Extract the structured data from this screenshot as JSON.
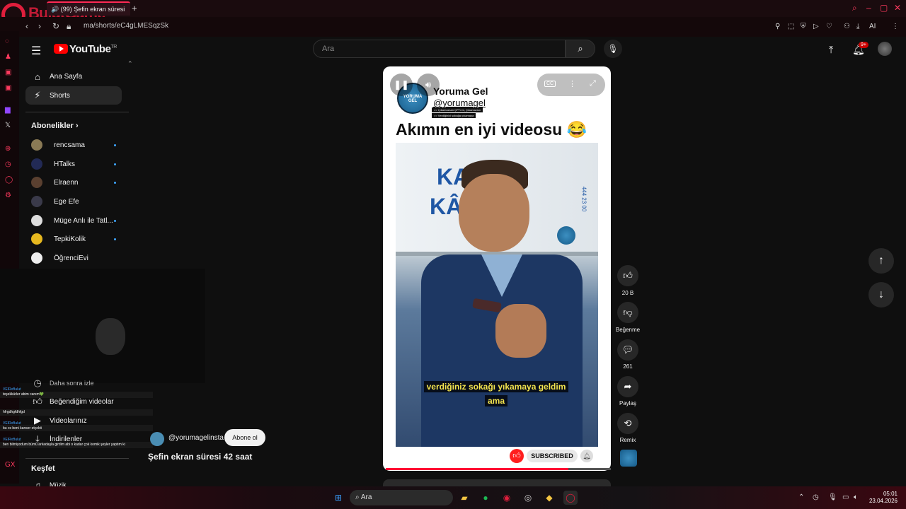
{
  "browser": {
    "tab_title": "(99) Şefin ekran süresi",
    "url": "ma/shorts/eC4gLMESqzSk",
    "brand_watermark": "BulutGame"
  },
  "header": {
    "logo_text": "YouTube",
    "logo_sup": "TR",
    "search_placeholder": "Ara",
    "notification_count": "9+"
  },
  "sidebar": {
    "items": [
      {
        "label": "Ana Sayfa",
        "icon": "home-icon"
      },
      {
        "label": "Shorts",
        "icon": "shorts-icon"
      }
    ],
    "subscriptions_title": "Abonelikler",
    "subscriptions": [
      {
        "name": "rencsama"
      },
      {
        "name": "HTalks"
      },
      {
        "name": "Elraenn"
      },
      {
        "name": "Ege Efe"
      },
      {
        "name": "Müge Anlı ile Tatl..."
      },
      {
        "name": "TepkiKolik"
      },
      {
        "name": "ÖğrenciEvi"
      }
    ],
    "you_items": [
      {
        "label": "Daha sonra izle"
      },
      {
        "label": "Beğendiğim videolar"
      },
      {
        "label": "Videolarınız"
      },
      {
        "label": "İndirilenler"
      }
    ],
    "explore_title": "Keşfet",
    "explore_items": [
      {
        "label": "Müzik"
      }
    ]
  },
  "chat": [
    {
      "user": "VEIRxBulut",
      "msg": "teşekkürler abim canım💚"
    },
    {
      "user": "",
      "msg": "hfrgdhgfdhfgd"
    },
    {
      "user": "VEIRxBulut",
      "msg": "bu cs beni kanser etçekti"
    },
    {
      "user": "VEIRxBulut",
      "msg": "ben bilmiyodum bümü arkadaşla girdim abi o kadar çok komik şeyler yaptım ki"
    }
  ],
  "short": {
    "channel_handle": "@yorumagelinsta",
    "subscribe_label": "Abone ol",
    "title": "Şefin ekran süresi 42 saat",
    "video_channel_name": "Yoruma Gel",
    "video_channel_handle": "@yorumagel",
    "video_logo_text": "YORUMA GEL",
    "video_tags": [
      ">> Çıkamazsan ÇPTırm, Çıkamazsın",
      ">> Verdiğinizi sokağa yıkamaya"
    ],
    "heading": "Akımın en iyi videosu 😂",
    "tank_text_1": "KAV",
    "tank_text_2": "KÂĞ",
    "tank_phone": "444 23 00",
    "caption_line1": "verdiğiniz sokağı yıkamaya geldim",
    "caption_line2": "ama",
    "subscribed_label": "SUBSCRIBED",
    "progress": 0.81
  },
  "actions": {
    "like_count": "20 B",
    "dislike_label": "Beğenme",
    "comments_count": "261",
    "share_label": "Paylaş",
    "remix_label": "Remix"
  },
  "taskbar": {
    "search_placeholder": "Ara",
    "time": "05:01",
    "date": "23.04.2026"
  },
  "colors": {
    "youtube_red": "#ff0000",
    "opera_red": "#e01e3c",
    "background": "#0f0f0f"
  }
}
